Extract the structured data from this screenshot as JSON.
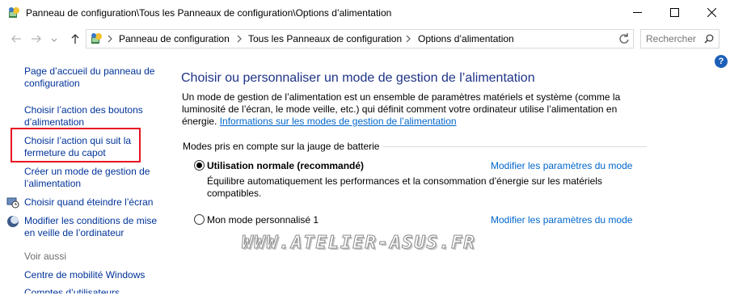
{
  "window": {
    "title": "Panneau de configuration\\Tous les Panneaux de configuration\\Options d’alimentation"
  },
  "address": {
    "breadcrumbs": [
      "Panneau de configuration",
      "Tous les Panneaux de configuration",
      "Options d’alimentation"
    ]
  },
  "search": {
    "placeholder": "Rechercher"
  },
  "help": {
    "label": "?"
  },
  "sidebar": {
    "items": [
      {
        "label": "Page d’accueil du panneau de configuration"
      },
      {
        "label": "Choisir l’action des boutons d’alimentation"
      },
      {
        "label": "Choisir l’action qui suit la fermeture du capot"
      },
      {
        "label": "Créer un mode de gestion de l’alimentation"
      },
      {
        "label": "Choisir quand éteindre l’écran"
      },
      {
        "label": "Modifier les conditions de mise en veille de l’ordinateur"
      }
    ],
    "see_also": {
      "title": "Voir aussi",
      "items": [
        {
          "label": "Centre de mobilité Windows"
        },
        {
          "label": "Comptes d’utilisateurs"
        }
      ]
    }
  },
  "main": {
    "title": "Choisir ou personnaliser un mode de gestion de l’alimentation",
    "description": "Un mode de gestion de l’alimentation est un ensemble de paramètres matériels et système (comme la luminosité de l’écran, le mode veille, etc.) qui définit comment votre ordinateur utilise l’alimentation en énergie.",
    "info_link": "Informations sur les modes de gestion de l’alimentation",
    "group_title": "Modes pris en compte sur la jauge de batterie",
    "plans": [
      {
        "name": "Utilisation normale (recommandé)",
        "selected": true,
        "description": "Équilibre automatiquement les performances et la consommation d’énergie sur les matériels compatibles.",
        "link": "Modifier les paramètres du mode"
      },
      {
        "name": "Mon mode personnalisé 1",
        "selected": false,
        "link": "Modifier les paramètres du mode"
      }
    ]
  },
  "watermark": {
    "text": "WWW.ATELIER-ASUS.FR"
  },
  "colors": {
    "link": "#0066cc",
    "title": "#1e3287",
    "highlight": "#e81123"
  }
}
